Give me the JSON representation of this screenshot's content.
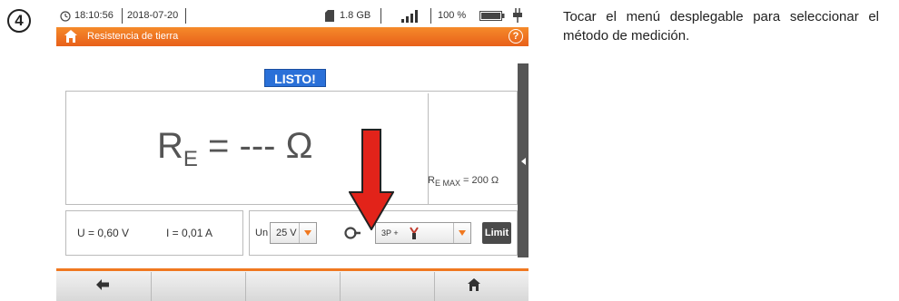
{
  "step": {
    "number": "4"
  },
  "status_bar": {
    "time": "18:10:56",
    "date": "2018-07-20",
    "storage": "1.8 GB",
    "battery_percent": "100 %"
  },
  "title_bar": {
    "title": "Resistencia de tierra",
    "help": "?"
  },
  "status": {
    "ready_label": "LISTO!"
  },
  "result": {
    "symbol": "R",
    "subscript": "E",
    "value": "= --- Ω"
  },
  "remax": {
    "symbol": "R",
    "subscript": "E MAX",
    "value": "= 200 Ω"
  },
  "measurements": {
    "u": "U = 0,60 V",
    "i": "I = 0,01 A"
  },
  "controls": {
    "un_label": "Un",
    "un_value": "25 V",
    "method_value": "3P +",
    "limit_label": "Limit"
  },
  "instruction": "Tocar el menú desplegable para seleccionar el método de medición.",
  "colors": {
    "accent": "#f07820",
    "ready": "#2a70d8",
    "arrow": "#e2231a"
  }
}
